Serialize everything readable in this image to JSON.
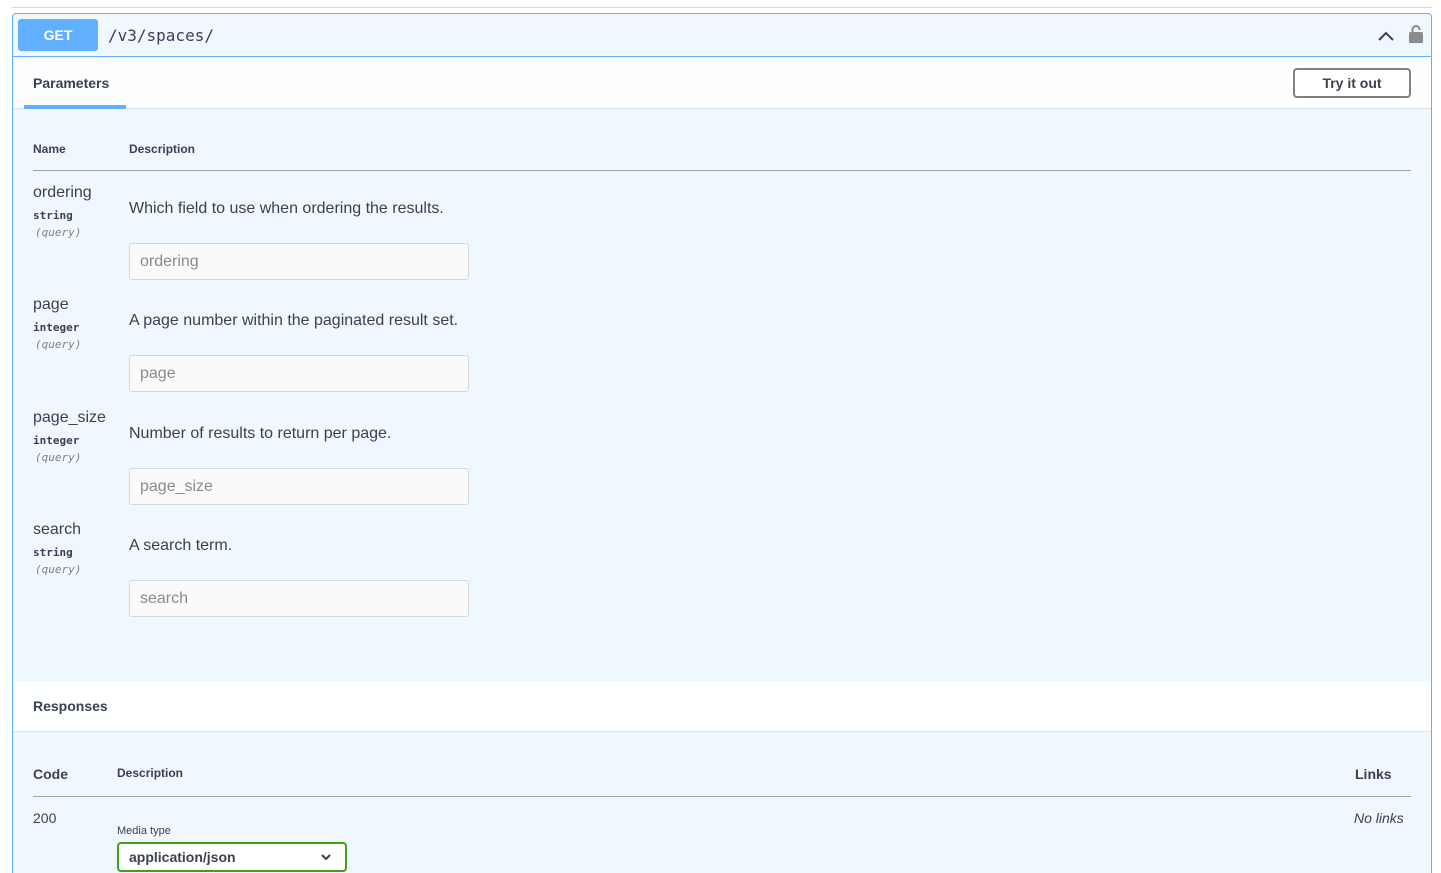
{
  "operation": {
    "method": "GET",
    "path": "/v3/spaces/",
    "icons": {
      "collapse": "chevron-up-icon",
      "auth": "unlocked-icon"
    },
    "colors": {
      "accent": "#61affe",
      "background": "#eff7ff",
      "media_select_border": "#41a018"
    }
  },
  "tabs": {
    "parameters": "Parameters",
    "try_it_out": "Try it out"
  },
  "parameters": {
    "headers": {
      "name": "Name",
      "description": "Description"
    },
    "items": [
      {
        "name": "ordering",
        "type": "string",
        "in": "(query)",
        "description": "Which field to use when ordering the results.",
        "placeholder": "ordering"
      },
      {
        "name": "page",
        "type": "integer",
        "in": "(query)",
        "description": "A page number within the paginated result set.",
        "placeholder": "page"
      },
      {
        "name": "page_size",
        "type": "integer",
        "in": "(query)",
        "description": "Number of results to return per page.",
        "placeholder": "page_size"
      },
      {
        "name": "search",
        "type": "string",
        "in": "(query)",
        "description": "A search term.",
        "placeholder": "search"
      }
    ]
  },
  "responses": {
    "title": "Responses",
    "headers": {
      "code": "Code",
      "description": "Description",
      "links": "Links"
    },
    "rows": [
      {
        "code": "200",
        "media_type_label": "Media type",
        "media_type": "application/json",
        "links": "No links"
      }
    ]
  }
}
